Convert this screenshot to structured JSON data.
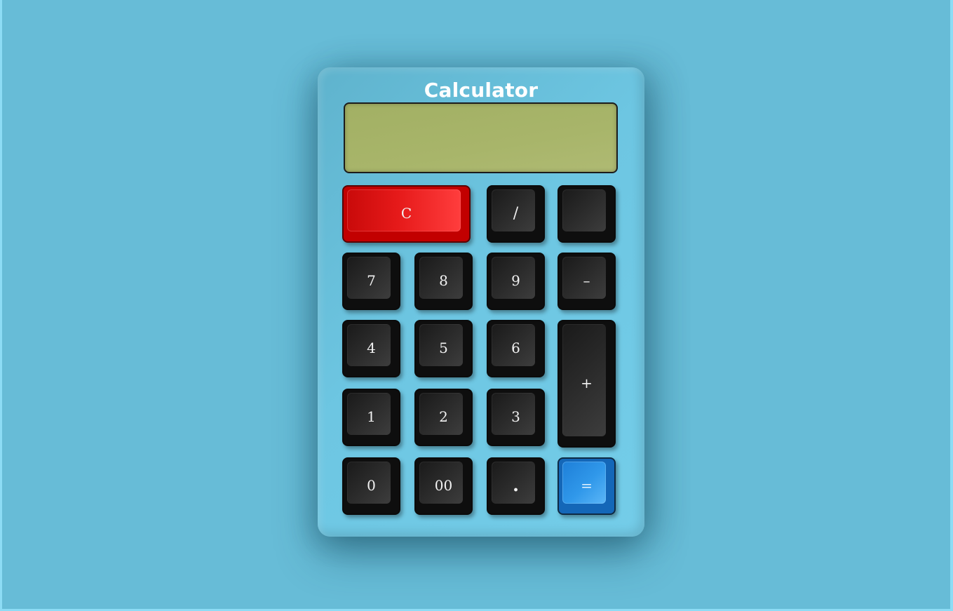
{
  "app": {
    "title": "Calculator"
  },
  "display": {
    "value": ""
  },
  "keys": {
    "clear": "C",
    "divide": "/",
    "multiply": "",
    "seven": "7",
    "eight": "8",
    "nine": "9",
    "minus": "–",
    "four": "4",
    "five": "5",
    "six": "6",
    "plus": "+",
    "one": "1",
    "two": "2",
    "three": "3",
    "zero": "0",
    "double_zero": "00",
    "decimal": ".",
    "equals": "="
  },
  "colors": {
    "background": "#67bcd7",
    "body": "#6dc6e2",
    "display": "#a8b56a",
    "key": "#2b2b2b",
    "clear_key": "#e61a1a",
    "equals_key": "#3098ea"
  }
}
